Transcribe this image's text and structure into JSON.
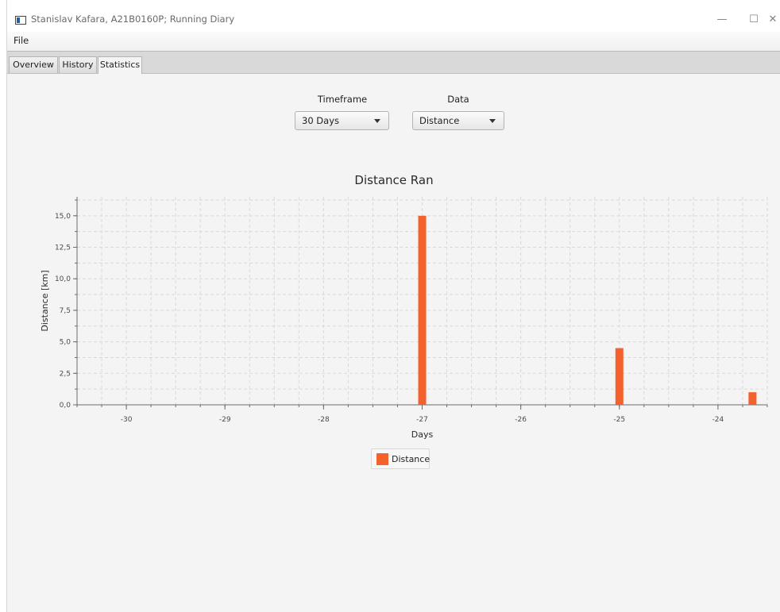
{
  "window": {
    "title": "Stanislav Kafara, A21B0160P; Running Diary",
    "controls": {
      "minimize": "—",
      "maximize": "☐",
      "close": "✕"
    }
  },
  "menu": {
    "file": "File"
  },
  "tabs": [
    {
      "label": "Overview",
      "active": false
    },
    {
      "label": "History",
      "active": false
    },
    {
      "label": "Statistics",
      "active": true
    }
  ],
  "controls": {
    "timeframe": {
      "label": "Timeframe",
      "value": "30 Days"
    },
    "data": {
      "label": "Data",
      "value": "Distance"
    }
  },
  "legend": {
    "label": "Distance"
  },
  "colors": {
    "bar": "#f3622d",
    "grid": "#d9d9d9",
    "axis": "#6b6b6b"
  },
  "chart_data": {
    "type": "bar",
    "title": "Distance Ran",
    "xlabel": "Days",
    "ylabel": "Distance [km]",
    "x_ticks": [
      "-30",
      "-29",
      "-28",
      "-27",
      "-26",
      "-25",
      "-24"
    ],
    "y_ticks": [
      "0,0",
      "2,5",
      "5,0",
      "7,5",
      "10,0",
      "12,5",
      "15,0"
    ],
    "xlim": [
      -30.5,
      -23.5
    ],
    "ylim": [
      0,
      16.5
    ],
    "grid": true,
    "legend_position": "bottom",
    "series": [
      {
        "name": "Distance",
        "points": [
          {
            "x": -27,
            "y": 15.0
          },
          {
            "x": -25,
            "y": 4.5
          },
          {
            "x": -23.65,
            "y": 1.0
          }
        ]
      }
    ]
  }
}
